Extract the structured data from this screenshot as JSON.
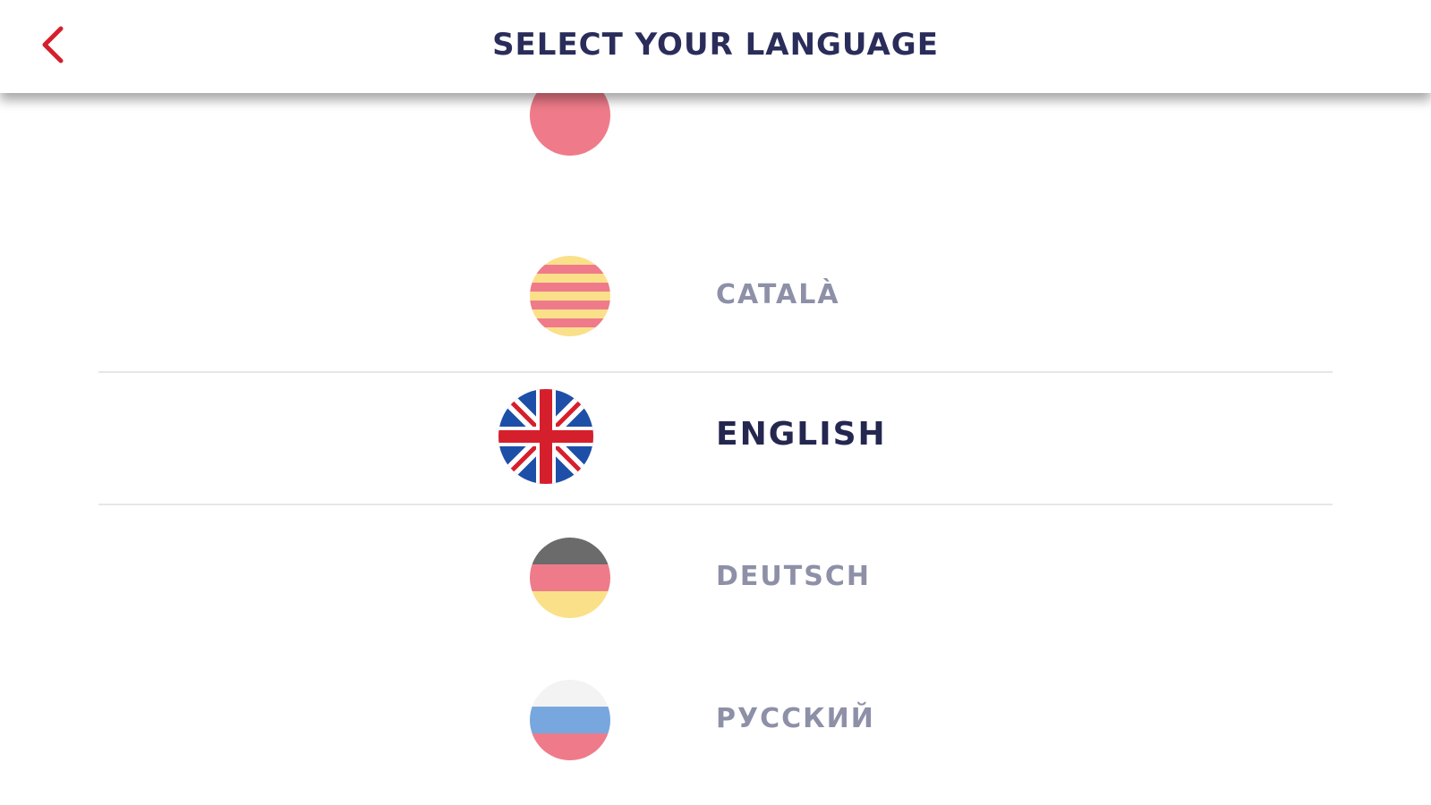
{
  "header": {
    "title": "SELECT YOUR LANGUAGE",
    "back_icon": "chevron-left-icon",
    "accent_color": "#d61f2c",
    "title_color": "#2a2d5a"
  },
  "languages": [
    {
      "label": "",
      "flag": "partial-flag-icon",
      "selected": false
    },
    {
      "label": "CATALÀ",
      "flag": "catalan-flag-icon",
      "selected": false
    },
    {
      "label": "ENGLISH",
      "flag": "uk-flag-icon",
      "selected": true
    },
    {
      "label": "DEUTSCH",
      "flag": "german-flag-icon",
      "selected": false
    },
    {
      "label": "РУССКИЙ",
      "flag": "russian-flag-icon",
      "selected": false
    }
  ]
}
